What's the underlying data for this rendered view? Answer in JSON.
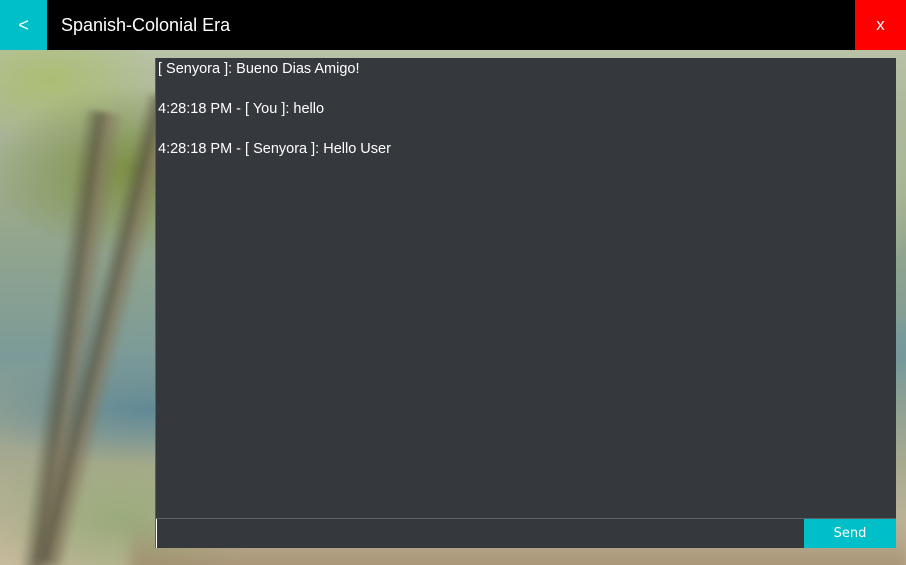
{
  "window": {
    "title": "Spanish-Colonial Era",
    "back_label": "<",
    "close_label": "x",
    "accent_color": "#00bfc8",
    "close_color": "#ff0000"
  },
  "chat": {
    "messages": [
      {
        "text": "[ Senyora ]: Bueno Dias Amigo!"
      },
      {
        "text": "4:28:18 PM - [ You ]: hello"
      },
      {
        "text": "4:28:18 PM - [ Senyora ]: Hello User"
      }
    ],
    "input_value": "",
    "send_label": "Send"
  }
}
